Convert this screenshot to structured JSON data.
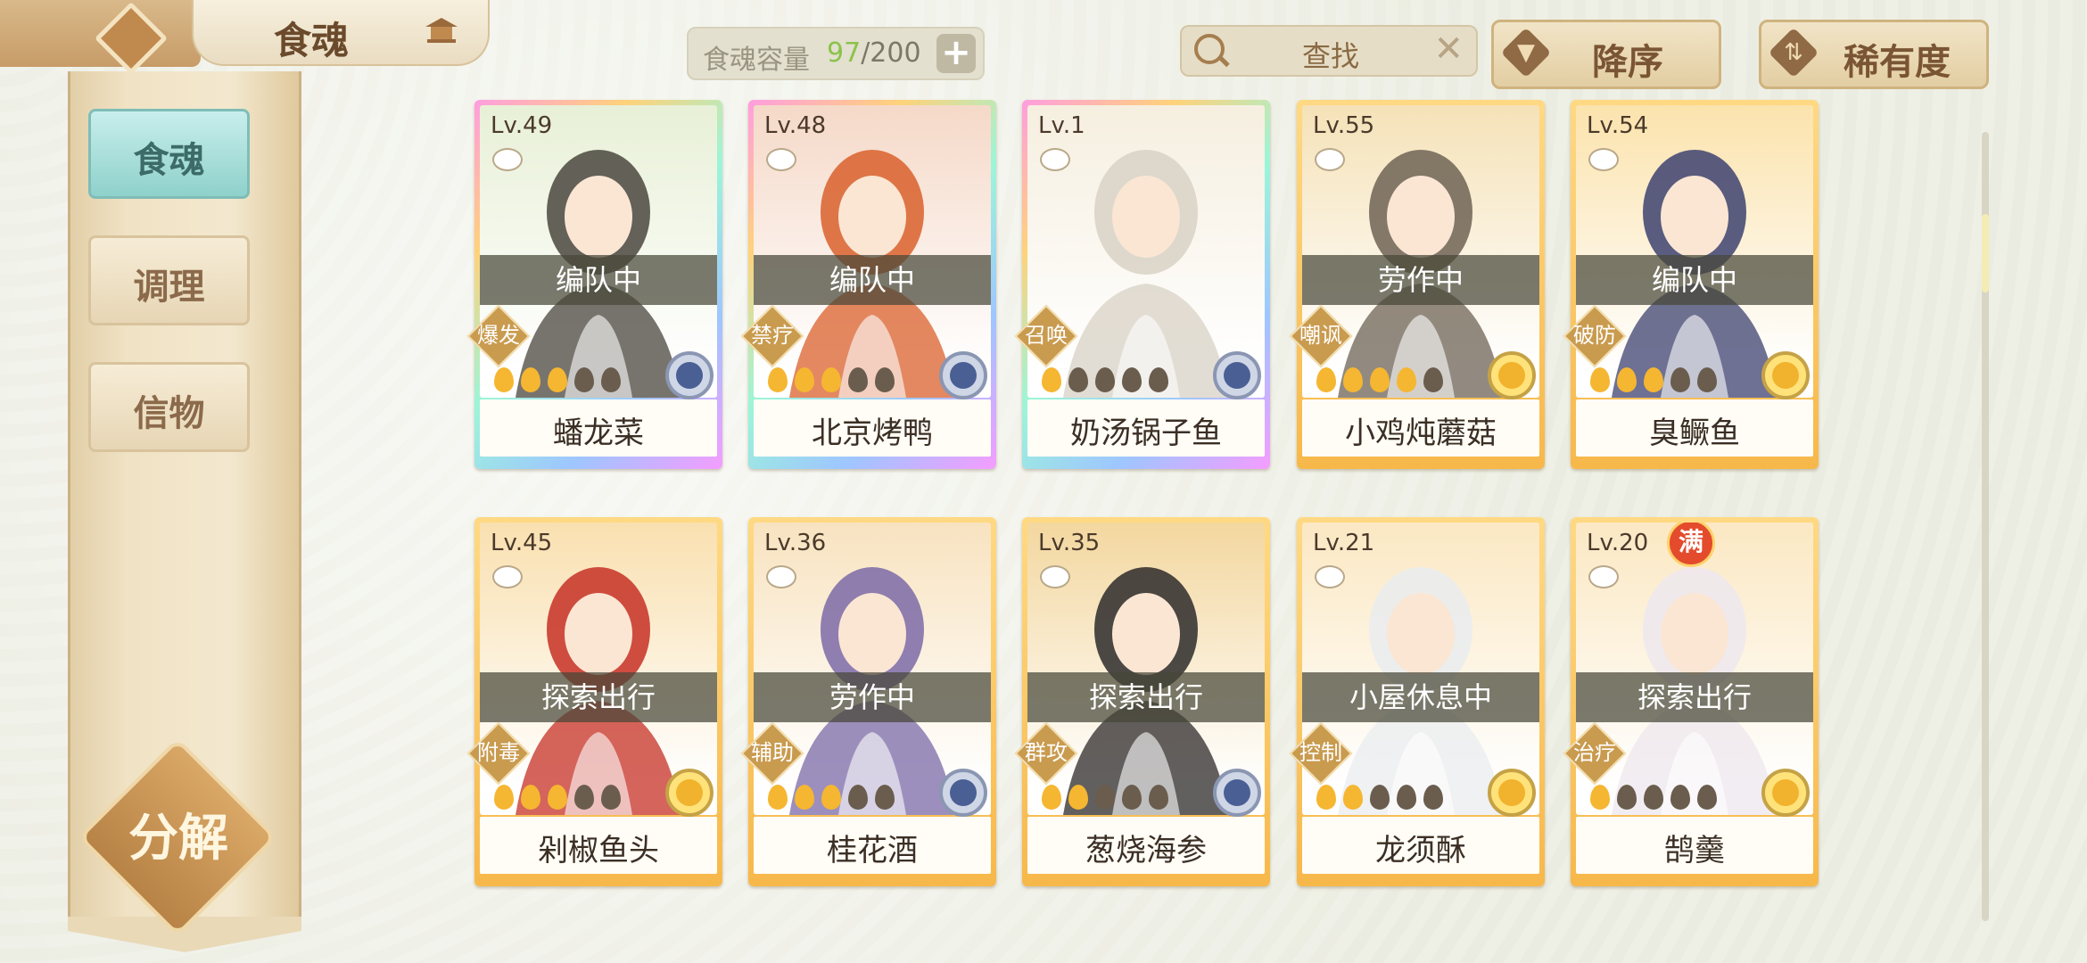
{
  "header": {
    "title": "食魂",
    "capacity_label": "食魂容量",
    "capacity_current": "97",
    "capacity_max": "/200",
    "capacity_add": "+",
    "search_text": "查找",
    "search_clear": "✕",
    "sort_order": "降序",
    "sort_by": "稀有度",
    "sort_order_icon": "▼",
    "sort_by_icon": "⇅"
  },
  "sidebar": {
    "tabs": [
      {
        "label": "食魂",
        "active": true
      },
      {
        "label": "调理",
        "active": false
      },
      {
        "label": "信物",
        "active": false
      }
    ],
    "decompose_label": "分解"
  },
  "cards": [
    {
      "level": "Lv.49",
      "status": "编队中",
      "tag": "爆发",
      "name": "蟠龙菜",
      "flames": 3,
      "frame": "rainbow",
      "medal": "blue",
      "art_colors": [
        "#e8f0d7",
        "#4a463e"
      ]
    },
    {
      "level": "Lv.48",
      "status": "编队中",
      "tag": "禁疗",
      "name": "北京烤鸭",
      "flames": 3,
      "frame": "rainbow",
      "medal": "blue",
      "art_colors": [
        "#f5d9c8",
        "#d9602c"
      ]
    },
    {
      "level": "Lv.1",
      "status": "",
      "tag": "召唤",
      "name": "奶汤锅子鱼",
      "flames": 1,
      "frame": "rainbow",
      "medal": "blue",
      "art_colors": [
        "#f6efe0",
        "#d8d2c6"
      ]
    },
    {
      "level": "Lv.55",
      "status": "劳作中",
      "tag": "嘲讽",
      "name": "小鸡炖蘑菇",
      "flames": 4,
      "frame": "gold",
      "medal": "yellow",
      "art_colors": [
        "#f5e2b8",
        "#6e6355"
      ]
    },
    {
      "level": "Lv.54",
      "status": "编队中",
      "tag": "破防",
      "name": "臭鳜鱼",
      "flames": 3,
      "frame": "gold",
      "medal": "yellow",
      "art_colors": [
        "#fbe3ad",
        "#3d4270"
      ]
    },
    {
      "level": "Lv.45",
      "status": "探索出行",
      "tag": "附毒",
      "name": "剁椒鱼头",
      "flames": 3,
      "frame": "gold",
      "medal": "yellow",
      "art_colors": [
        "#f9e0b0",
        "#c53025"
      ]
    },
    {
      "level": "Lv.36",
      "status": "劳作中",
      "tag": "辅助",
      "name": "桂花酒",
      "flames": 3,
      "frame": "gold",
      "medal": "blue",
      "art_colors": [
        "#f8e3c0",
        "#7b6aa7"
      ]
    },
    {
      "level": "Lv.35",
      "status": "探索出行",
      "tag": "群攻",
      "name": "葱烧海参",
      "flames": 2,
      "frame": "gold",
      "medal": "blue",
      "art_colors": [
        "#f3d79f",
        "#2d2a2a"
      ]
    },
    {
      "level": "Lv.21",
      "status": "小屋休息中",
      "tag": "控制",
      "name": "龙须酥",
      "flames": 2,
      "frame": "gold",
      "medal": "yellow",
      "art_colors": [
        "#fbe8c3",
        "#e9ecef"
      ]
    },
    {
      "level": "Lv.20",
      "status": "探索出行",
      "tag": "治疗",
      "name": "鹄羹",
      "flames": 1,
      "frame": "gold",
      "medal": "yellow",
      "full_badge": "满",
      "art_colors": [
        "#fbe8c3",
        "#ede7ee"
      ]
    }
  ]
}
